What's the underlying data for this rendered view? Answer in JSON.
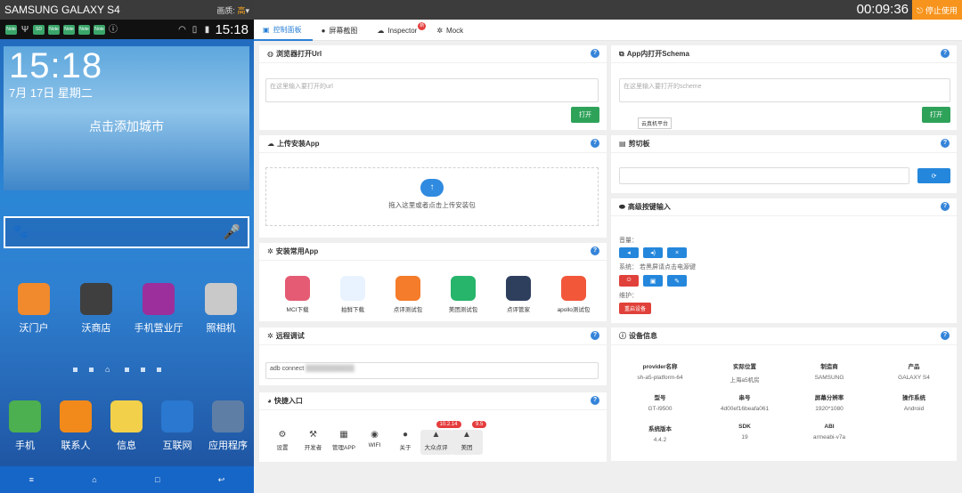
{
  "phone": {
    "title": "SAMSUNG GALAXY S4",
    "quality_label": "画质:",
    "quality_value": "高",
    "status_time": "15:18",
    "clock": "15:18",
    "date": "7月 17日 星期二",
    "add_city": "点击添加城市",
    "apps_row1": [
      {
        "label": "沃门户",
        "color": "#f08a2c"
      },
      {
        "label": "沃商店",
        "color": "#3f3f3f"
      },
      {
        "label": "手机营业厅",
        "color": "#9c2f9c"
      },
      {
        "label": "照相机",
        "color": "#c9c9c9"
      }
    ],
    "apps_row2": [
      {
        "label": "手机",
        "color": "#4caf50"
      },
      {
        "label": "联系人",
        "color": "#f28a1b"
      },
      {
        "label": "信息",
        "color": "#f3d04a"
      },
      {
        "label": "互联网",
        "color": "#2a78d0"
      },
      {
        "label": "应用程序",
        "color": "#5f7ea6"
      }
    ],
    "nav": [
      "≡",
      "⌂",
      "□",
      "↩"
    ]
  },
  "topbar": {
    "timer": "00:09:36",
    "stop_label": "停止使用"
  },
  "tabs": [
    {
      "label": "控制面板",
      "icon": "dashboard-icon"
    },
    {
      "label": "屏幕截图",
      "icon": "camera-icon"
    },
    {
      "label": "Inspector",
      "icon": "cloud-icon",
      "badge": "新"
    },
    {
      "label": "Mock",
      "icon": "gear-icon"
    }
  ],
  "browser": {
    "title": "浏览器打开Url",
    "placeholder": "在这里输入要打开的url",
    "button": "打开"
  },
  "schema": {
    "title": "App内打开Schema",
    "placeholder": "在这里输入要打开的scheme",
    "button": "打开",
    "tooltip": "云真机平台"
  },
  "upload": {
    "title": "上传安装App",
    "hint": "拖入这里或者点击上传安装包"
  },
  "clipboard": {
    "title": "剪切板"
  },
  "keys": {
    "title": "高级按键输入",
    "volume": "音量：",
    "system": "系统：",
    "system_hint": "若黑屏请点击电源键",
    "maintain": "维护：",
    "restart": "重启设备"
  },
  "common": {
    "title": "安装常用App",
    "apps": [
      {
        "label": "MCI下载",
        "color": "#e45b73"
      },
      {
        "label": "拍鲜下载",
        "color": "#e9f3ff"
      },
      {
        "label": "点评测试包",
        "color": "#f47c2a"
      },
      {
        "label": "美团测试包",
        "color": "#27b46b"
      },
      {
        "label": "点评管家",
        "color": "#2e3f5e"
      },
      {
        "label": "apollo测试包",
        "color": "#f2573a"
      }
    ]
  },
  "remote": {
    "title": "远程调试",
    "cmd": "adb connect"
  },
  "device": {
    "title": "设备信息",
    "rows": [
      [
        {
          "k": "provider名称",
          "v": "sh-a5-platform-64"
        },
        {
          "k": "实际位置",
          "v": "上海a5机房"
        },
        {
          "k": "制造商",
          "v": "SAMSUNG"
        },
        {
          "k": "产品",
          "v": "GALAXY S4"
        }
      ],
      [
        {
          "k": "型号",
          "v": "GT-I9500"
        },
        {
          "k": "串号",
          "v": "4d00ef16beafa061"
        },
        {
          "k": "屏幕分辨率",
          "v": "1920*1080"
        },
        {
          "k": "操作系统",
          "v": "Android"
        }
      ],
      [
        {
          "k": "系统版本",
          "v": "4.4.2"
        },
        {
          "k": "SDK",
          "v": "19"
        },
        {
          "k": "ABI",
          "v": "armeabi-v7a"
        }
      ]
    ]
  },
  "quick": {
    "title": "快捷入口",
    "items": [
      {
        "label": "设置",
        "icon": "⚙"
      },
      {
        "label": "开发者",
        "icon": "⚒"
      },
      {
        "label": "管理APP",
        "icon": "▦"
      },
      {
        "label": "WIFI",
        "icon": "◉"
      },
      {
        "label": "关于",
        "icon": "●"
      },
      {
        "label": "大众点评",
        "icon": "▲",
        "badge": "10.2.14"
      },
      {
        "label": "美团",
        "icon": "▲",
        "badge": "9.5"
      }
    ]
  }
}
